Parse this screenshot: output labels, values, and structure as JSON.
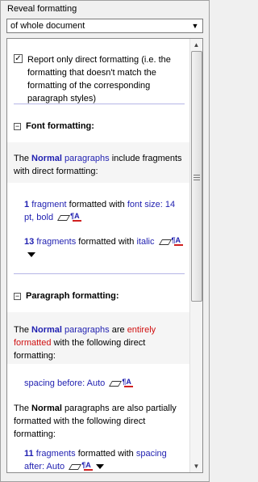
{
  "panel": {
    "title": "Reveal formatting",
    "scope_select": "of whole document"
  },
  "options": {
    "direct_only_checked": true,
    "direct_only_label": "Report only direct formatting (i.e. the formatting that doesn't match the formatting of the corresponding paragraph styles)"
  },
  "font_section": {
    "heading": "Font formatting:",
    "intro_the": "The",
    "intro_style": "Normal",
    "intro_paragraphs": "paragraphs",
    "intro_rest": "include fragments with direct formatting:",
    "item1": {
      "count": "1",
      "unit": "fragment",
      "mid": "formatted with",
      "value": "font size: 14 pt, bold"
    },
    "item2": {
      "count": "13",
      "unit": "fragments",
      "mid": "formatted with",
      "value": "italic"
    }
  },
  "paragraph_section": {
    "heading": "Paragraph formatting:",
    "p1_the": "The",
    "p1_style": "Normal",
    "p1_paragraphs": "paragraphs",
    "p1_are": "are",
    "p1_entirely": "entirely formatted",
    "p1_rest": "with the following direct formatting:",
    "item1_value": "spacing before: Auto",
    "p2_the": "The",
    "p2_style": "Normal",
    "p2_rest": "paragraphs are also partially formatted with the following direct formatting:",
    "item2": {
      "count": "11",
      "unit": "fragments",
      "mid": "formatted with",
      "value": "spacing after: Auto"
    }
  },
  "icons": [
    "checkbox",
    "minus-box-icon",
    "eraser-icon",
    "format-painter-icon",
    "dropdown-arrow-icon"
  ]
}
